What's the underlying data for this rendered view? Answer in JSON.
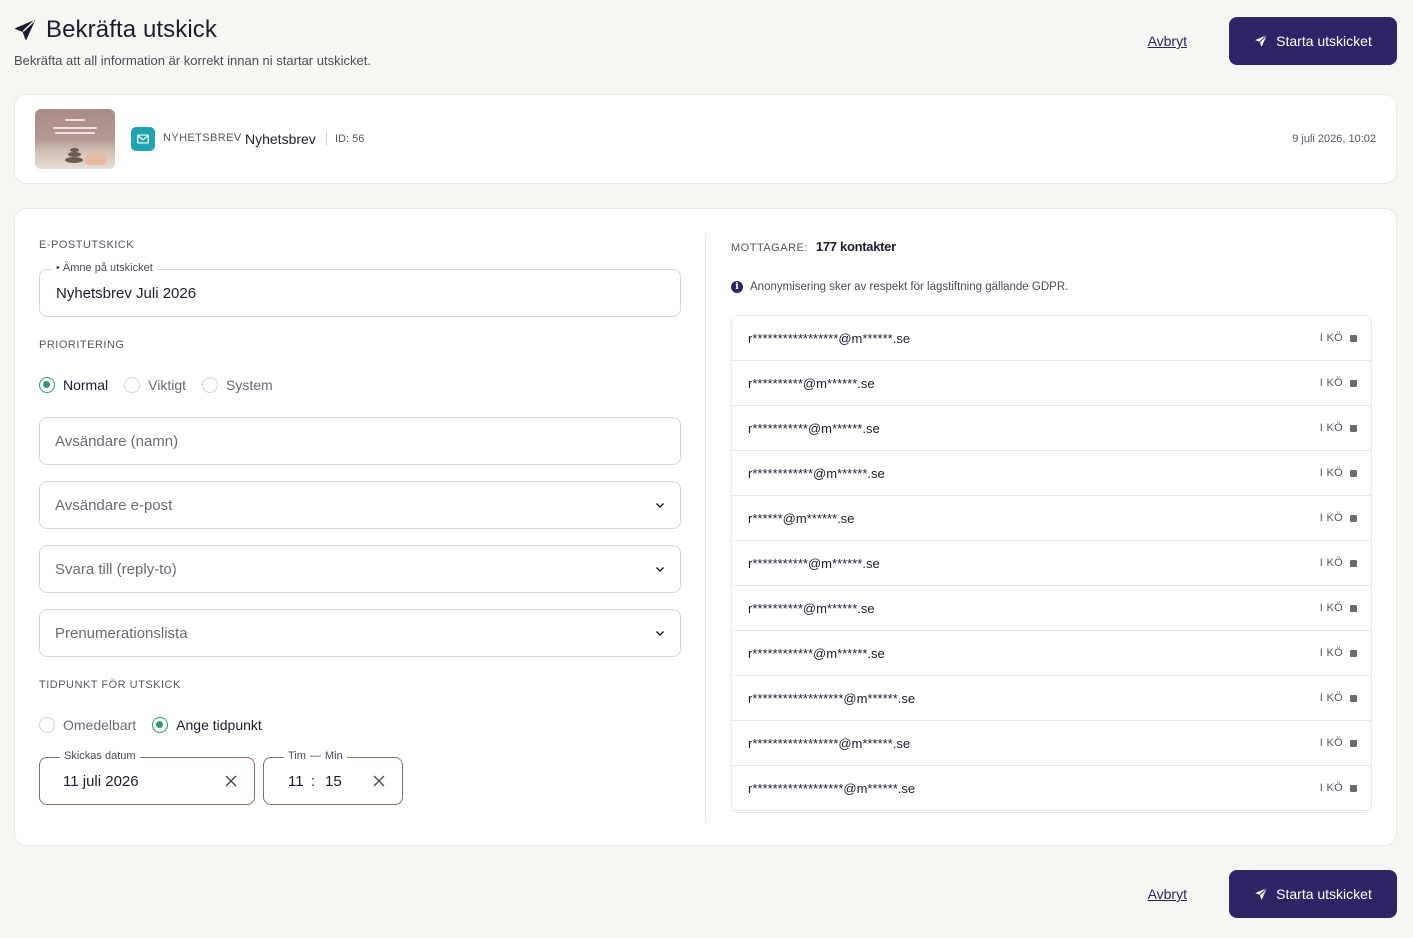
{
  "header": {
    "title": "Bekräfta utskick",
    "subtitle": "Bekräfta att all information är korrekt innan ni startar utskicket.",
    "cancel_label": "Avbryt",
    "start_label": "Starta utskicket"
  },
  "newsletter": {
    "type": "NYHETSBREV",
    "name": "Nyhetsbrev",
    "id": "ID: 56",
    "date": "9 juli 2026, 10:02"
  },
  "form": {
    "section_label": "E-POSTUTSKICK",
    "subject_legend": "• Ämne på utskicket",
    "subject_value": "Nyhetsbrev Juli 2026",
    "priority_label": "PRIORITERING",
    "priority_options": [
      "Normal",
      "Viktigt",
      "System"
    ],
    "priority_selected": "Normal",
    "sender_name_placeholder": "Avsändare (namn)",
    "sender_email_placeholder": "Avsändare e-post",
    "reply_to_placeholder": "Svara till (reply-to)",
    "subscription_list_placeholder": "Prenumerationslista",
    "schedule_label": "TIDPUNKT FÖR UTSKICK",
    "schedule_options": [
      "Omedelbart",
      "Ange tidpunkt"
    ],
    "schedule_selected": "Ange tidpunkt",
    "date_legend": "Skickas datum",
    "date_value": "11 juli 2026",
    "hour_legend": "Tim",
    "legend_dash": "—",
    "minute_legend": "Min",
    "hour_value": "11",
    "time_separator": ":",
    "minute_value": "15"
  },
  "recipients": {
    "label": "MOTTAGARE:",
    "count": "177 kontakter",
    "gdpr_note": "Anonymisering sker av respekt för lagstiftning gällande GDPR.",
    "rows": [
      {
        "email": "r*****************@m******.se",
        "status": "I KÖ"
      },
      {
        "email": "r**********@m******.se",
        "status": "I KÖ"
      },
      {
        "email": "r***********@m******.se",
        "status": "I KÖ"
      },
      {
        "email": "r************@m******.se",
        "status": "I KÖ"
      },
      {
        "email": "r******@m******.se",
        "status": "I KÖ"
      },
      {
        "email": "r***********@m******.se",
        "status": "I KÖ"
      },
      {
        "email": "r**********@m******.se",
        "status": "I KÖ"
      },
      {
        "email": "r************@m******.se",
        "status": "I KÖ"
      },
      {
        "email": "r******************@m******.se",
        "status": "I KÖ"
      },
      {
        "email": "r*****************@m******.se",
        "status": "I KÖ"
      },
      {
        "email": "r******************@m******.se",
        "status": "I KÖ"
      }
    ]
  },
  "colors": {
    "primary": "#2d2566",
    "accent_green": "#2f9a6c",
    "mail_badge": "#1fa4b0",
    "background": "#f7f6f3"
  }
}
